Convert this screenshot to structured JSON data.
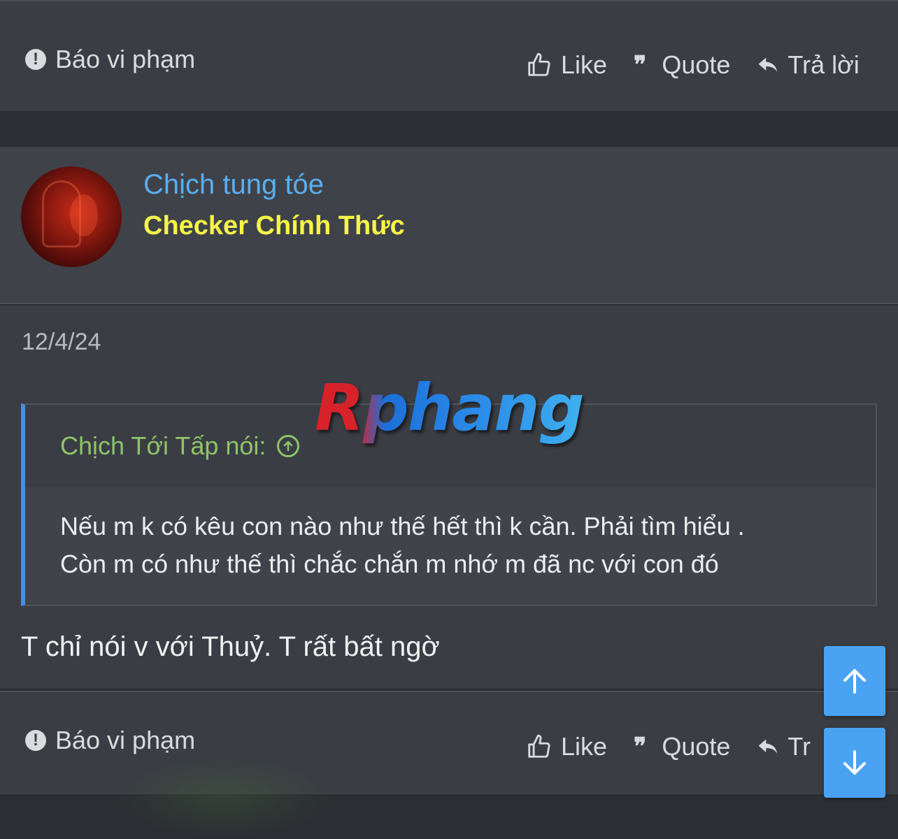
{
  "top_actions": {
    "report_label": "Báo vi phạm",
    "like_label": "Like",
    "quote_label": "Quote",
    "reply_label": "Trả lời"
  },
  "post": {
    "username": "Chịch tung tóe",
    "user_title": "Checker Chính Thức",
    "date": "12/4/24",
    "quote": {
      "author": "Chịch Tới Tấp nói:",
      "lines": [
        "Nếu m k có kêu con nào như thế hết thì k cần. Phải tìm hiểu .",
        "Còn m có như thế thì chắc chắn m nhớ m đã nc với con đó"
      ]
    },
    "text": "T chỉ nói v với Thuỷ. T rất bất ngờ"
  },
  "bottom_actions": {
    "report_label": "Báo vi phạm",
    "like_label": "Like",
    "quote_label": "Quote",
    "reply_label": "Tr"
  },
  "watermark": "Rphang",
  "colors": {
    "username": "#5aaef0",
    "user_title": "#f7f547",
    "quote_author": "#8fc46a",
    "quote_border": "#4a90d9",
    "scroll_button": "#4aa3f2"
  },
  "icons": [
    "exclamation-circle-icon",
    "thumbs-up-icon",
    "quote-icon",
    "reply-icon",
    "arrow-circle-up-icon",
    "arrow-up-icon",
    "arrow-down-icon"
  ]
}
